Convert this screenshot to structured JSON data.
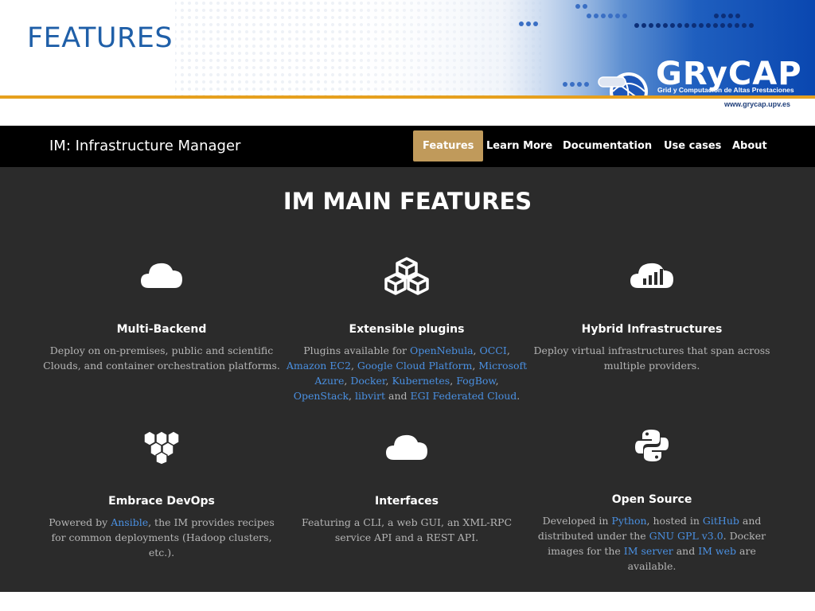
{
  "slide": {
    "title": "FEATURES",
    "logo": {
      "name": "GRyCAP",
      "subtitle": "Grid y Computación de Altas Prestaciones",
      "url": "www.grycap.upv.es"
    }
  },
  "navbar": {
    "brand": "IM: Infrastructure Manager",
    "items": [
      {
        "label": "Features",
        "active": true
      },
      {
        "label": "Learn More",
        "active": false
      },
      {
        "label": "Documentation",
        "active": false
      },
      {
        "label": "Use cases",
        "active": false
      },
      {
        "label": "About",
        "active": false
      }
    ]
  },
  "main": {
    "title": "IM MAIN FEATURES",
    "features": [
      {
        "icon": "cloud-icon",
        "title": "Multi-Backend",
        "desc": [
          "Deploy on on-premises, public and scientific",
          "Clouds, and container orchestration platforms."
        ]
      },
      {
        "icon": "cubes-icon",
        "title": "Extensible plugins",
        "desc_prefix": "Plugins available for",
        "links": [
          "OpenNebula",
          "OCCI",
          "Amazon EC2",
          "Google Cloud Platform",
          "Microsoft Azure",
          "Docker",
          "Kubernetes",
          "FogBow",
          "OpenStack",
          "libvirt",
          "EGI Federated Cloud"
        ],
        "desc_and": "and"
      },
      {
        "icon": "cloud-chart-icon",
        "title": "Hybrid Infrastructures",
        "desc": [
          "Deploy virtual infrastructures that span across",
          "multiple providers."
        ]
      },
      {
        "icon": "boxes-icon",
        "title": "Embrace DevOps",
        "desc_prefix": "Powered by",
        "link": "Ansible",
        "desc_suffix": ", the IM provides recipes",
        "desc_line2": "for common deployments (Hadoop clusters,",
        "desc_line3": "etc.)."
      },
      {
        "icon": "cloud-icon",
        "title": "Interfaces",
        "desc": [
          "Featuring a CLI, a web GUI, an XML-RPC",
          "service API and a REST API."
        ]
      },
      {
        "icon": "python-icon",
        "title": "Open Source",
        "desc_parts": {
          "a": "Developed in",
          "python": "Python",
          "b": ", hosted in",
          "github": "GitHub",
          "c": "and",
          "d": "distributed under the",
          "gpl": "GNU GPL v3.0",
          "e": ". Docker",
          "f": "images for the",
          "imserver": "IM server",
          "g": "and",
          "imweb": "IM web",
          "h": "are",
          "i": "available."
        }
      }
    ]
  },
  "colors": {
    "title_blue": "#1f5fa8",
    "gold": "#e6a01e",
    "nav_active": "#c09a5b",
    "link": "#4a90e2",
    "site_bg": "#2b2b2b"
  }
}
